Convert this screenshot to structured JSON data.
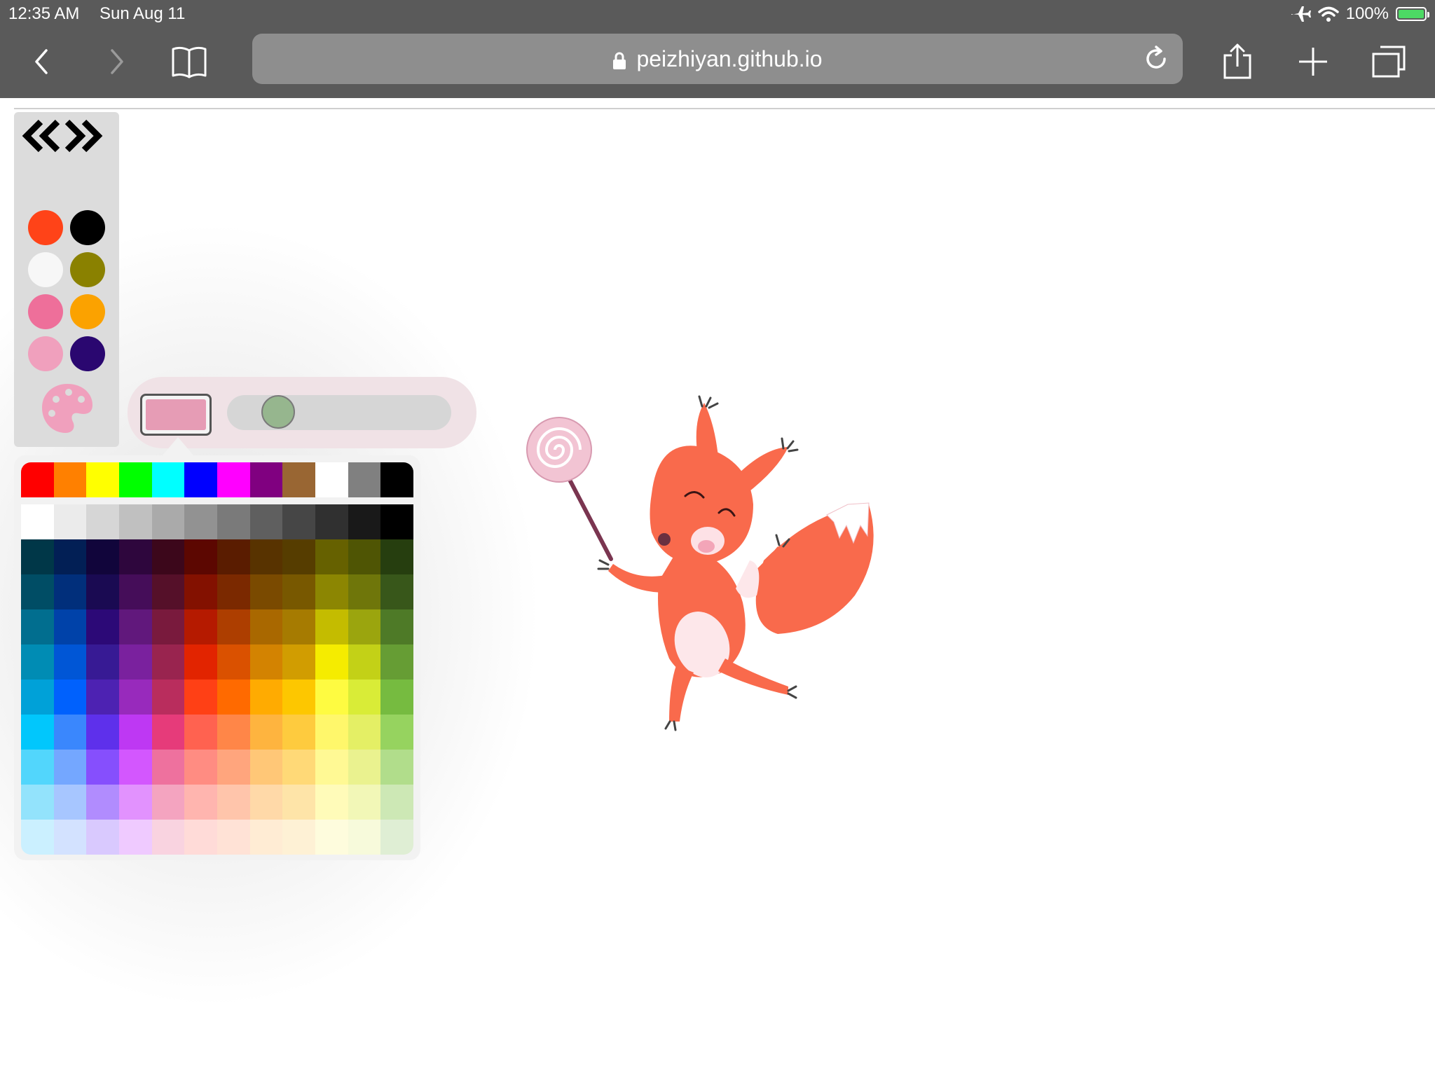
{
  "status_bar": {
    "time": "12:35 AM",
    "date": "Sun Aug 11",
    "battery": "100%"
  },
  "browser": {
    "url": "peizhiyan.github.io",
    "buttons": [
      "back",
      "forward",
      "bookmarks",
      "reload",
      "share",
      "new-tab",
      "tabs"
    ]
  },
  "tools": {
    "swatches": [
      "#ff4318",
      "#000000",
      "#f7f7f7",
      "#8a8100",
      "#ee6f9a",
      "#fba200",
      "#f0a0bd",
      "#2a0770"
    ],
    "palette_icon_color": "#f0a0bd",
    "current_color": "#e69cb5",
    "brush_size": 0.18
  },
  "picker": {
    "top_row": [
      "#ff0000",
      "#ff8000",
      "#ffff00",
      "#00ff00",
      "#00ffff",
      "#0000ff",
      "#ff00ff",
      "#800080",
      "#996633",
      "#ffffff",
      "#808080",
      "#000000"
    ],
    "gray_row": [
      "#ffffff",
      "#ebebeb",
      "#d6d6d6",
      "#c0c0c0",
      "#aaaaaa",
      "#929292",
      "#7a7a7a",
      "#5f5f5f",
      "#464646",
      "#303030",
      "#191919",
      "#000000"
    ],
    "rows": [
      [
        "#003748",
        "#021f55",
        "#11053b",
        "#2e063d",
        "#3c071b",
        "#5c0701",
        "#5a1c00",
        "#583300",
        "#563d00",
        "#666100",
        "#4f5504",
        "#263e0f"
      ],
      [
        "#004d65",
        "#012f7b",
        "#1a0a52",
        "#450d59",
        "#551029",
        "#831100",
        "#7b2900",
        "#7a4a00",
        "#785800",
        "#8c8602",
        "#6f760a",
        "#38571a"
      ],
      [
        "#016e8f",
        "#0042a9",
        "#2c0977",
        "#61187c",
        "#791a3d",
        "#b51a00",
        "#ad3e00",
        "#a96800",
        "#a67b01",
        "#c4bc00",
        "#9ba50e",
        "#4e7a27"
      ],
      [
        "#008cb4",
        "#0056d6",
        "#371a94",
        "#7a219e",
        "#99244f",
        "#e22400",
        "#da5100",
        "#d38301",
        "#d19d01",
        "#f5ec00",
        "#c3d117",
        "#669d34"
      ],
      [
        "#00a1d8",
        "#0061fd",
        "#4d22b2",
        "#982abc",
        "#b92d5d",
        "#ff4015",
        "#ff6a00",
        "#ffab01",
        "#fdc700",
        "#fefb41",
        "#d9ec37",
        "#76bb40"
      ],
      [
        "#01c7fc",
        "#3a87fd",
        "#5e30eb",
        "#be38f3",
        "#e63b7a",
        "#ff6250",
        "#ff8648",
        "#feb43f",
        "#fecb3e",
        "#fff76b",
        "#e4ef65",
        "#96d35f"
      ],
      [
        "#52d6fc",
        "#74a7ff",
        "#864ffd",
        "#d357fe",
        "#ee719e",
        "#ff8c82",
        "#ffa57d",
        "#ffc777",
        "#ffd977",
        "#fff994",
        "#eaf28f",
        "#b1dd8b"
      ],
      [
        "#93e3fc",
        "#a7c6ff",
        "#b18cfe",
        "#e292fe",
        "#f4a4c0",
        "#ffb5af",
        "#ffc5ab",
        "#ffd9a8",
        "#fee4a8",
        "#fffbb9",
        "#f2f7b7",
        "#cde8b5"
      ],
      [
        "#cbf0ff",
        "#d3e2ff",
        "#d9c9fe",
        "#efcaff",
        "#f9d3e0",
        "#ffdbd8",
        "#ffe2d6",
        "#ffecd4",
        "#fef1d5",
        "#fefcdd",
        "#f7fadb",
        "#dfeed4"
      ]
    ]
  }
}
